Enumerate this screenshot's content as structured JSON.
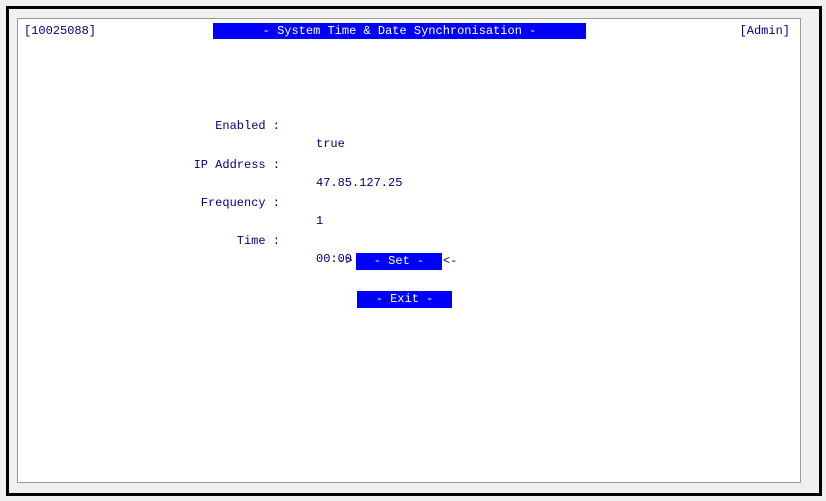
{
  "header": {
    "id": "[10025088]",
    "title": "- System Time & Date Synchronisation -",
    "user": "[Admin]"
  },
  "fields": [
    {
      "label": "Enabled :",
      "value": "true"
    },
    {
      "label": "IP Address :",
      "value": "47.85.127.25"
    },
    {
      "label": "Frequency :",
      "value": "1"
    },
    {
      "label": "Time :",
      "value": "00:00"
    }
  ],
  "buttons": {
    "set_arrow_left": "->",
    "set_label": "- Set -",
    "set_arrow_right": "<-",
    "exit_label": "- Exit -"
  },
  "colors": {
    "highlight": "#0000ff",
    "text": "#000080",
    "background": "#ffffff"
  }
}
